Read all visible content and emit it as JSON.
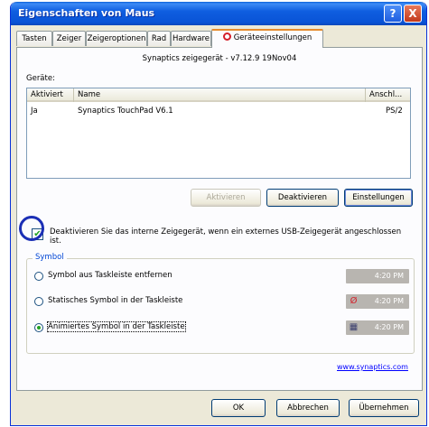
{
  "window": {
    "title": "Eigenschaften von Maus",
    "help_button": "?",
    "close_button": "X"
  },
  "tabs": [
    {
      "label": "Tasten"
    },
    {
      "label": "Zeiger"
    },
    {
      "label": "Zeigeroptionen"
    },
    {
      "label": "Rad"
    },
    {
      "label": "Hardware"
    },
    {
      "label": "Geräteeinstellungen",
      "active": true
    }
  ],
  "device_title": "Synaptics zeigegerät - v7.12.9 19Nov04",
  "devices": {
    "section_label": "Geräte:",
    "columns": [
      "Aktiviert",
      "Name",
      "Anschl..."
    ],
    "rows": [
      {
        "enabled": "Ja",
        "name": "Synaptics TouchPad V6.1",
        "port": "PS/2"
      }
    ]
  },
  "device_buttons": {
    "activate": "Aktivieren",
    "deactivate": "Deaktivieren",
    "settings": "Einstellungen"
  },
  "disable_internal": {
    "checked": true,
    "check_glyph": "✔",
    "text": "Deaktivieren Sie das interne Zeigegerät, wenn ein externes USB-Zeigegerät angeschlossen ist."
  },
  "symbol_group": {
    "title": "Symbol",
    "options": [
      {
        "label": "Symbol aus Taskleiste entfernen",
        "selected": false,
        "clock": "4:20 PM",
        "icon": "none"
      },
      {
        "label": "Statisches Symbol in der Taskleiste",
        "selected": false,
        "clock": "4:20 PM",
        "icon": "synaptics-static-icon",
        "icon_glyph": "Ø"
      },
      {
        "label": "Animiertes Symbol in der Taskleiste",
        "selected": true,
        "clock": "4:20 PM",
        "icon": "synaptics-animated-icon",
        "icon_glyph": "▦"
      }
    ]
  },
  "link": "www.synaptics.com",
  "dialog_buttons": {
    "ok": "OK",
    "cancel": "Abbrechen",
    "apply": "Übernehmen"
  },
  "colors": {
    "titlebar": "#0a5fd8",
    "annotation_circle": "#1b2fb5",
    "active_tab_accent": "#e68b2c"
  }
}
